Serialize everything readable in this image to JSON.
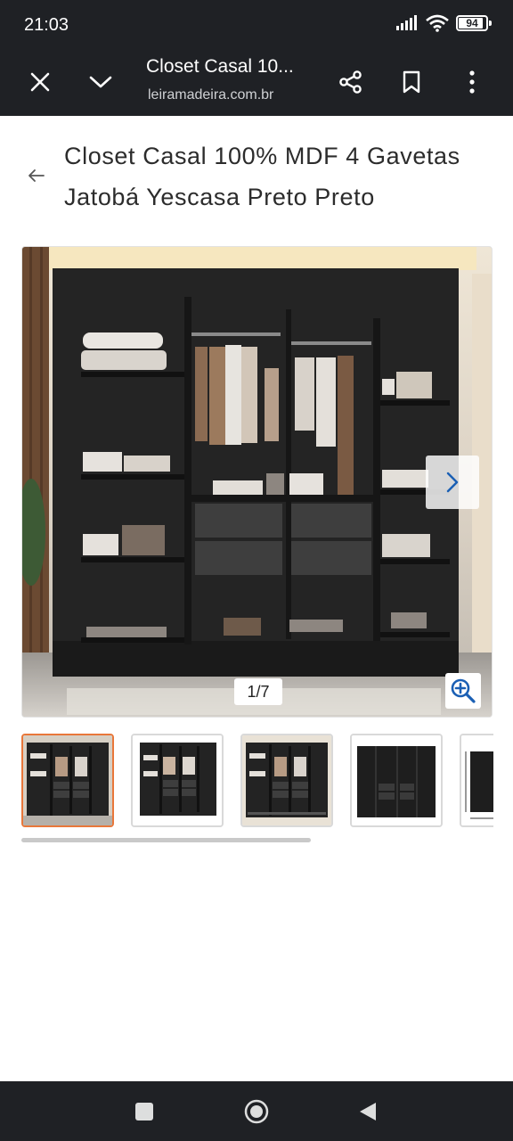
{
  "status_bar": {
    "time": "21:03",
    "battery": "94"
  },
  "browser": {
    "title": "Closet Casal 10...",
    "url": "leiramadeira.com.br",
    "icons": [
      "close-icon",
      "chevron-down-icon",
      "share-icon",
      "bookmark-icon",
      "more-vert-icon"
    ]
  },
  "product": {
    "title": "Closet Casal 100% MDF 4 Gavetas Jatobá Yescasa Preto Preto"
  },
  "gallery": {
    "counter": "1/7",
    "thumbnail_count": 5,
    "active_index": 0
  },
  "nav": {
    "icons": [
      "recents-square-icon",
      "home-circle-icon",
      "back-triangle-icon"
    ]
  },
  "colors": {
    "bar_bg": "#1f2125",
    "active_thumb_border": "#e8773a",
    "accent_blue": "#1a73e8"
  }
}
